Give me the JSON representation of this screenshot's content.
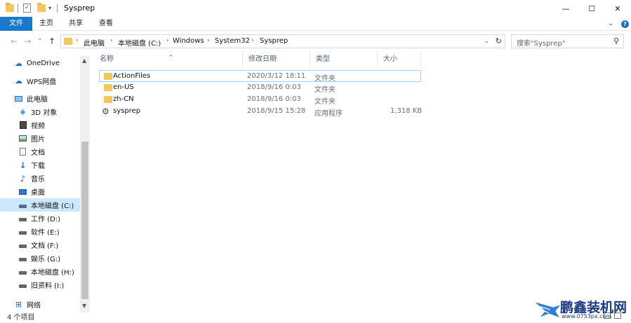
{
  "window": {
    "title": "Sysprep",
    "minimize_glyph": "—",
    "maximize_glyph": "☐",
    "close_glyph": "✕"
  },
  "ribbon": {
    "tabs": [
      "文件",
      "主页",
      "共享",
      "查看"
    ]
  },
  "navigation": {
    "back_glyph": "←",
    "forward_glyph": "→",
    "recent_glyph": "⌄",
    "up_glyph": "↑"
  },
  "address": {
    "crumbs": [
      "此电脑",
      "本地磁盘 (C:)",
      "Windows",
      "System32",
      "Sysprep"
    ]
  },
  "search": {
    "placeholder": "搜索\"Sysprep\""
  },
  "sidebar": {
    "items": [
      {
        "label": "OneDrive",
        "icon": "cloud-icon"
      },
      {
        "label": "WPS网盘",
        "icon": "wps-cloud-icon"
      },
      {
        "label": "此电脑",
        "icon": "computer-icon"
      },
      {
        "label": "3D 对象",
        "icon": "3d-objects-icon"
      },
      {
        "label": "视频",
        "icon": "video-icon"
      },
      {
        "label": "图片",
        "icon": "pictures-icon"
      },
      {
        "label": "文档",
        "icon": "documents-icon"
      },
      {
        "label": "下载",
        "icon": "download-icon"
      },
      {
        "label": "音乐",
        "icon": "music-icon"
      },
      {
        "label": "桌面",
        "icon": "desktop-icon"
      },
      {
        "label": "本地磁盘 (C:)",
        "icon": "system-drive-icon"
      },
      {
        "label": "工作 (D:)",
        "icon": "drive-icon"
      },
      {
        "label": "软件 (E:)",
        "icon": "drive-icon"
      },
      {
        "label": "文档 (F:)",
        "icon": "drive-icon"
      },
      {
        "label": "娱乐 (G:)",
        "icon": "drive-icon"
      },
      {
        "label": "本地磁盘 (H:)",
        "icon": "drive-icon"
      },
      {
        "label": "旧资料 (I:)",
        "icon": "drive-icon"
      },
      {
        "label": "网络",
        "icon": "network-icon"
      }
    ],
    "selected": "本地磁盘 (C:)"
  },
  "columns": {
    "name": "名称",
    "modified": "修改日期",
    "type": "类型",
    "size": "大小"
  },
  "files": [
    {
      "name": "ActionFiles",
      "modified": "2020/3/12 18:11",
      "type": "文件夹",
      "size": "",
      "icon": "folder-icon"
    },
    {
      "name": "en-US",
      "modified": "2018/9/16 0:03",
      "type": "文件夹",
      "size": "",
      "icon": "folder-icon"
    },
    {
      "name": "zh-CN",
      "modified": "2018/9/16 0:03",
      "type": "文件夹",
      "size": "",
      "icon": "folder-icon"
    },
    {
      "name": "sysprep",
      "modified": "2018/9/15 15:28",
      "type": "应用程序",
      "size": "1,318 KB",
      "icon": "application-icon"
    }
  ],
  "status": {
    "item_count": "4 个项目"
  },
  "watermark": {
    "title": "鹏鑫装机网",
    "url": "www.0753px.com"
  },
  "colors": {
    "accent": "#1979ca",
    "selection": "#cce8ff",
    "folder": "#f3c75c",
    "watermark": "#1a3a86"
  }
}
